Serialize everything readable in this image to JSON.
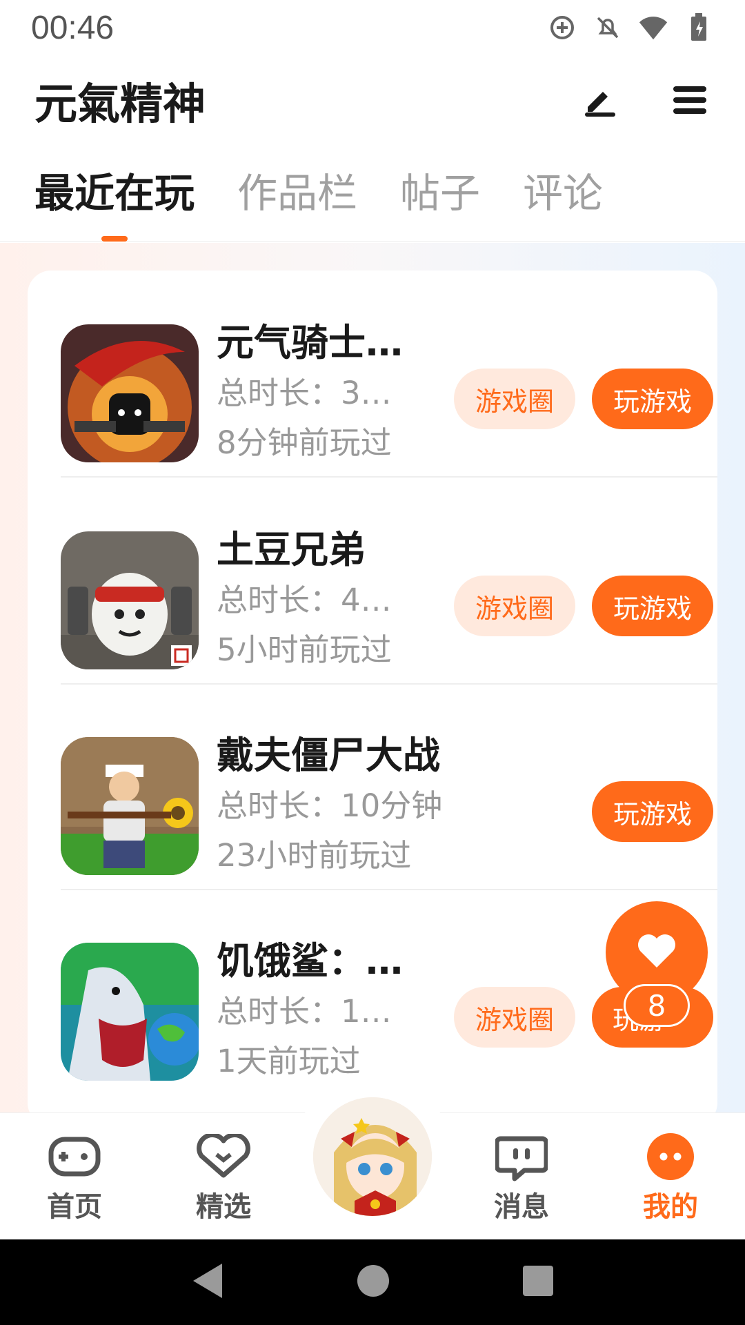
{
  "status_bar": {
    "time": "00:46"
  },
  "header": {
    "title": "元氣精神"
  },
  "tabs": [
    {
      "label": "最近在玩",
      "active": true
    },
    {
      "label": "作品栏",
      "active": false
    },
    {
      "label": "帖子",
      "active": false
    },
    {
      "label": "评论",
      "active": false
    }
  ],
  "games": [
    {
      "name": "元气骑士…",
      "total_time": "总时长：3…",
      "last_played": "8分钟前玩过",
      "circle_label": "游戏圈",
      "play_label": "玩游戏",
      "has_circle": true
    },
    {
      "name": "土豆兄弟",
      "total_time": "总时长：4…",
      "last_played": "5小时前玩过",
      "circle_label": "游戏圈",
      "play_label": "玩游戏",
      "has_circle": true
    },
    {
      "name": "戴夫僵尸大战",
      "total_time": "总时长：10分钟",
      "last_played": "23小时前玩过",
      "play_label": "玩游戏",
      "has_circle": false
    },
    {
      "name": "饥饿鲨：…",
      "total_time": "总时长：1…",
      "last_played": "1天前玩过",
      "circle_label": "游戏圈",
      "play_label": "玩游",
      "has_circle": true
    }
  ],
  "floating_like": {
    "count": "8",
    "icon": "heart-icon"
  },
  "bottom_nav": [
    {
      "label": "首页",
      "icon": "gamepad-icon",
      "active": false
    },
    {
      "label": "精选",
      "icon": "heart-chat-icon",
      "active": false
    },
    {
      "label": "消息",
      "icon": "chat-bubble-icon",
      "active": false
    },
    {
      "label": "我的",
      "icon": "profile-face-icon",
      "active": true
    }
  ],
  "colors": {
    "accent": "#ff6a1a",
    "accent_light": "#ffe9dd"
  }
}
